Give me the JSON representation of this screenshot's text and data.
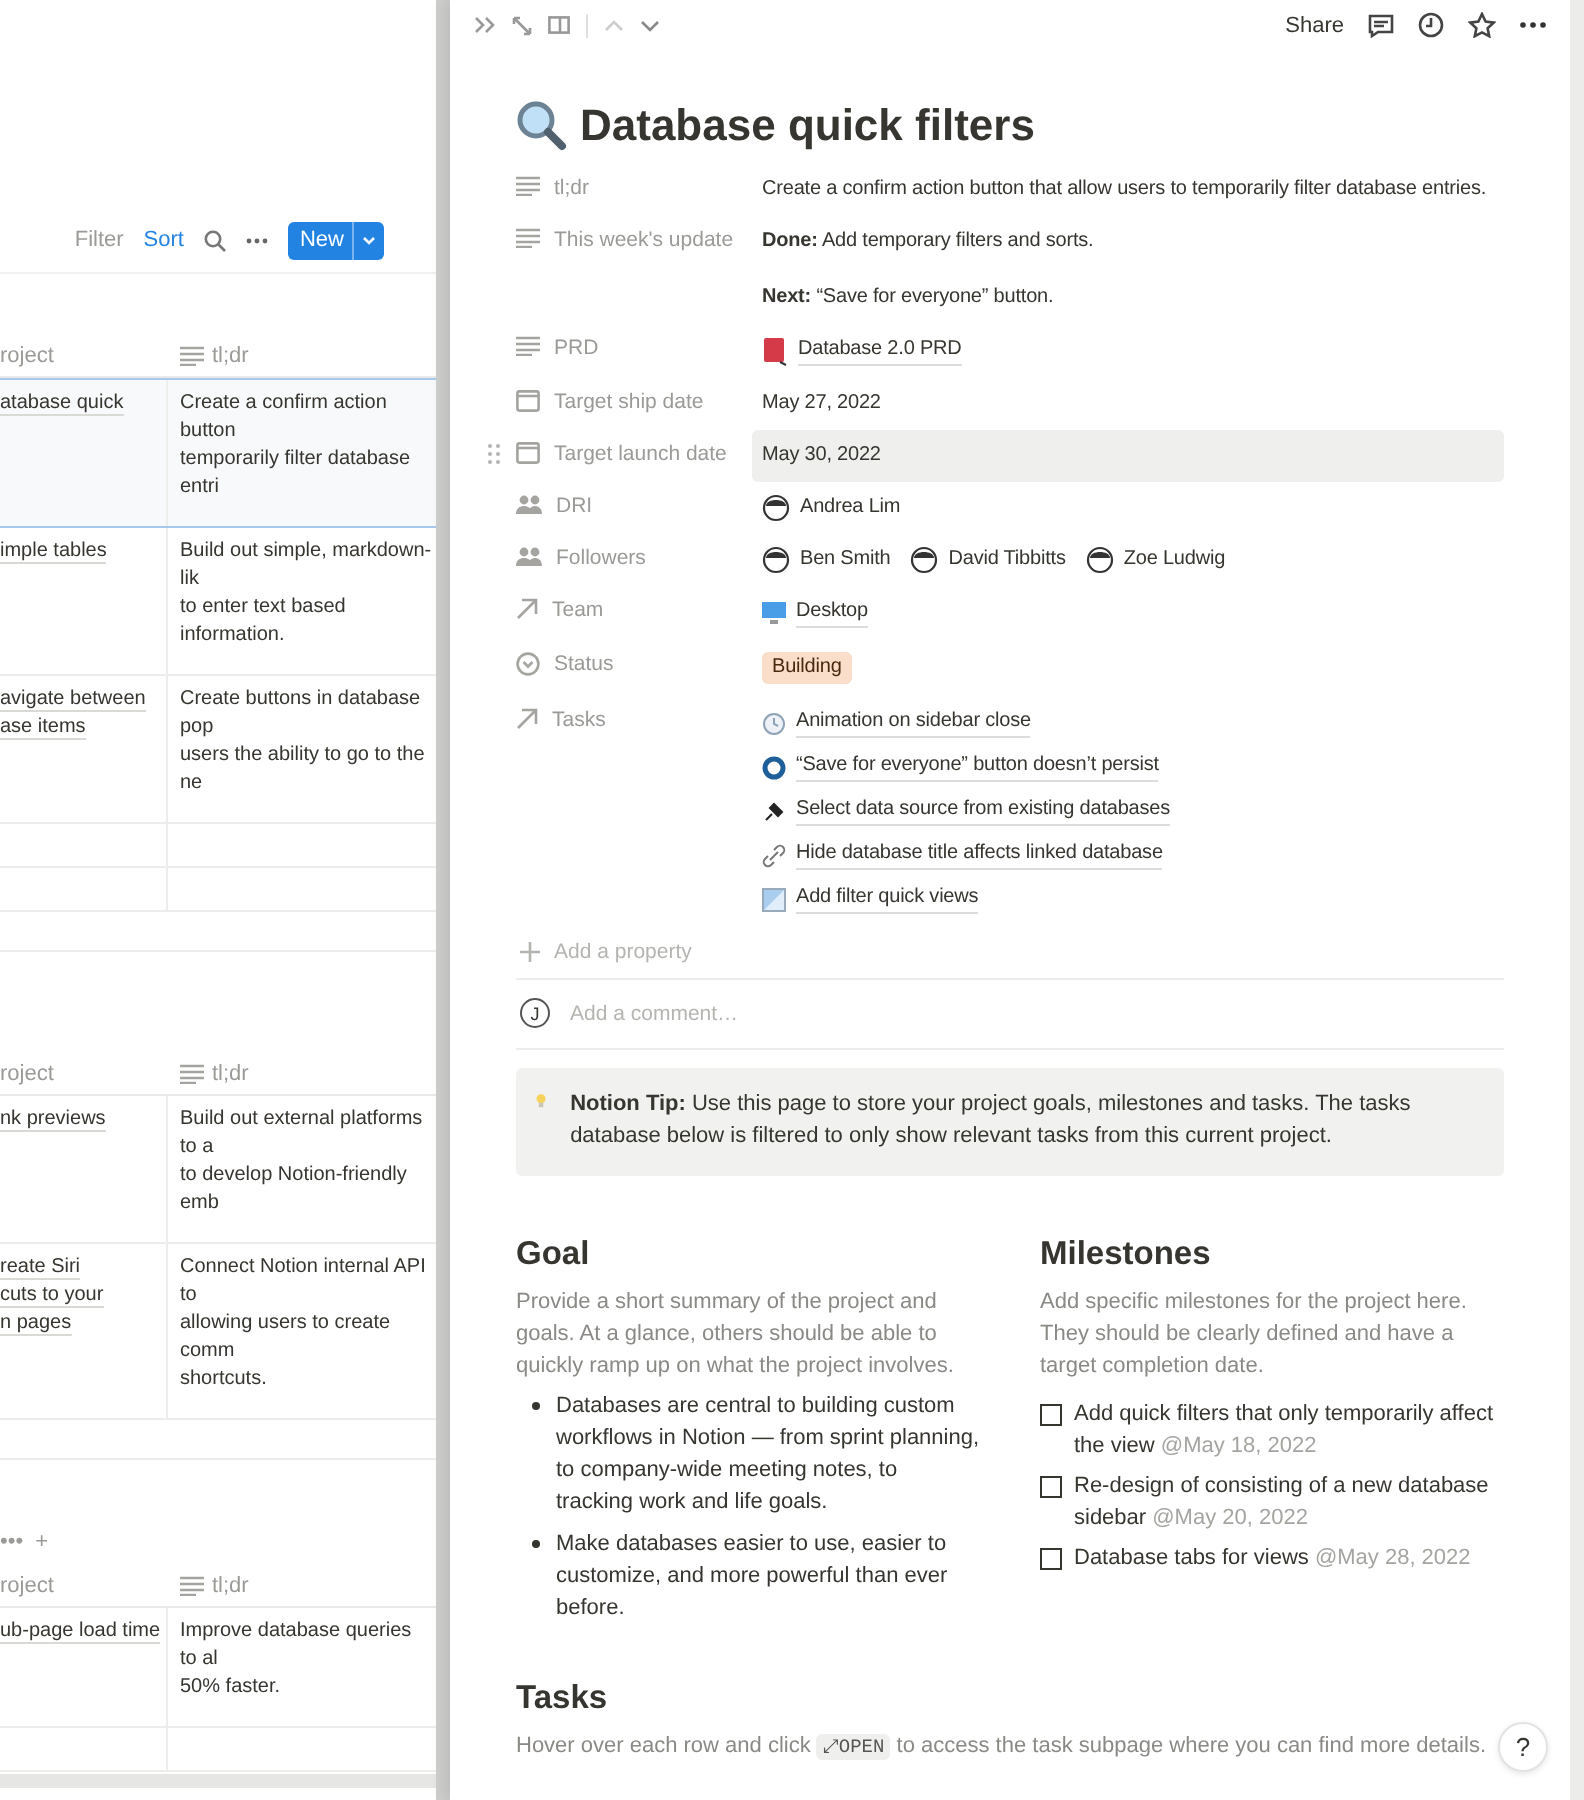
{
  "board": {
    "toolbar": {
      "filter": "Filter",
      "sort": "Sort",
      "new_button": "New"
    },
    "tables": [
      {
        "columns": [
          "roject",
          "tl;dr"
        ],
        "rows": [
          {
            "selected": true,
            "project": [
              "atabase quick"
            ],
            "tldr": [
              "Create a confirm action button",
              "temporarily filter database entri"
            ]
          },
          {
            "selected": false,
            "project": [
              "imple tables"
            ],
            "tldr": [
              "Build out simple, markdown-lik",
              "to enter text based information."
            ]
          },
          {
            "selected": false,
            "project": [
              "avigate between",
              "ase items"
            ],
            "tldr": [
              "Create buttons in database pop",
              "users the ability to go to the ne"
            ]
          },
          {
            "selected": false,
            "project": [],
            "tldr": []
          },
          {
            "selected": false,
            "project": [],
            "tldr": []
          }
        ]
      },
      {
        "columns": [
          "roject",
          "tl;dr"
        ],
        "rows": [
          {
            "selected": false,
            "project": [
              "nk previews"
            ],
            "tldr": [
              "Build out external platforms to a",
              "to develop Notion-friendly emb"
            ]
          },
          {
            "selected": false,
            "project": [
              "reate Siri",
              "cuts to your",
              "n pages"
            ],
            "tldr": [
              "Connect Notion internal API to",
              "allowing users to create comm",
              "shortcuts."
            ]
          }
        ]
      },
      {
        "view_controls": {
          "more": "•••",
          "add": "+"
        },
        "columns": [
          "roject",
          "tl;dr"
        ],
        "rows": [
          {
            "selected": false,
            "project": [
              "ub-page load time"
            ],
            "tldr": [
              "Improve database queries to al",
              "50% faster."
            ]
          },
          {
            "selected": false,
            "project": [],
            "tldr": []
          }
        ]
      }
    ]
  },
  "peek": {
    "topbar": {
      "share": "Share"
    },
    "title": "Database quick filters",
    "properties": [
      {
        "label": "tl;dr",
        "kind": "text",
        "hovered": false,
        "paragraphs": [
          "Create a confirm action button that allow users to temporarily filter database entries."
        ]
      },
      {
        "label": "This week's update",
        "kind": "text",
        "hovered": false,
        "paragraphs": [
          "**Done:** Add temporary filters and sorts.",
          "**Next:** “Save for everyone” button."
        ]
      },
      {
        "label": "PRD",
        "kind": "text",
        "hovered": false,
        "links": [
          "Database 2.0 PRD"
        ]
      },
      {
        "label": "Target ship date",
        "kind": "date",
        "hovered": false,
        "paragraphs": [
          "May 27, 2022"
        ]
      },
      {
        "label": "Target launch date",
        "kind": "date",
        "hovered": true,
        "paragraphs": [
          "May 30, 2022"
        ]
      },
      {
        "label": "DRI",
        "kind": "person",
        "hovered": false,
        "people": [
          "Andrea Lim"
        ]
      },
      {
        "label": "Followers",
        "kind": "person",
        "hovered": false,
        "people": [
          "Ben Smith",
          "David Tibbitts",
          "Zoe Ludwig"
        ]
      },
      {
        "label": "Team",
        "kind": "relation",
        "hovered": false,
        "links": [
          "Desktop"
        ]
      },
      {
        "label": "Status",
        "kind": "select",
        "hovered": false,
        "tag": "Building"
      },
      {
        "label": "Tasks",
        "kind": "relation",
        "hovered": false,
        "links": [
          "Animation on sidebar close",
          "“Save for everyone” button doesn’t persist",
          "Select data source from existing databases",
          "Hide database title affects linked database",
          "Add filter quick views"
        ]
      }
    ],
    "add_property": "Add a property",
    "comment": {
      "avatar": "J",
      "placeholder": "Add a comment…"
    },
    "tip": "**Notion Tip:** Use this page to store your project goals, milestones and tasks. The tasks database below is filtered to only show relevant tasks from this current project.",
    "goal": {
      "heading": "Goal",
      "intro": "Provide a short summary of the project and goals. At a glance, others should be able to quickly ramp up on what the project involves.",
      "bullets": [
        "Databases are central to building custom workflows in Notion — from sprint planning, to company-wide meeting notes, to tracking work and life goals.",
        "Make databases easier to use, easier to customize, and more powerful than ever before."
      ]
    },
    "milestones": {
      "heading": "Milestones",
      "intro": "Add specific milestones for the project here. They should be clearly defined and have a target completion date.",
      "items": [
        {
          "text": "Add quick filters that only temporarily affect the view",
          "date": "@May 18, 2022",
          "checked": false
        },
        {
          "text": "Re-design of consisting of a new database sidebar",
          "date": "@May 20, 2022",
          "checked": false
        },
        {
          "text": "Database tabs for views",
          "date": "@May 28, 2022",
          "checked": false
        }
      ]
    },
    "tasks": {
      "heading": "Tasks",
      "description": [
        {
          "kind": "text",
          "text": "Hover over each row and click "
        },
        {
          "kind": "code",
          "text": "⤢OPEN"
        },
        {
          "kind": "text",
          "text": " to access the task subpage where you can find more details."
        }
      ]
    },
    "help": "?"
  }
}
